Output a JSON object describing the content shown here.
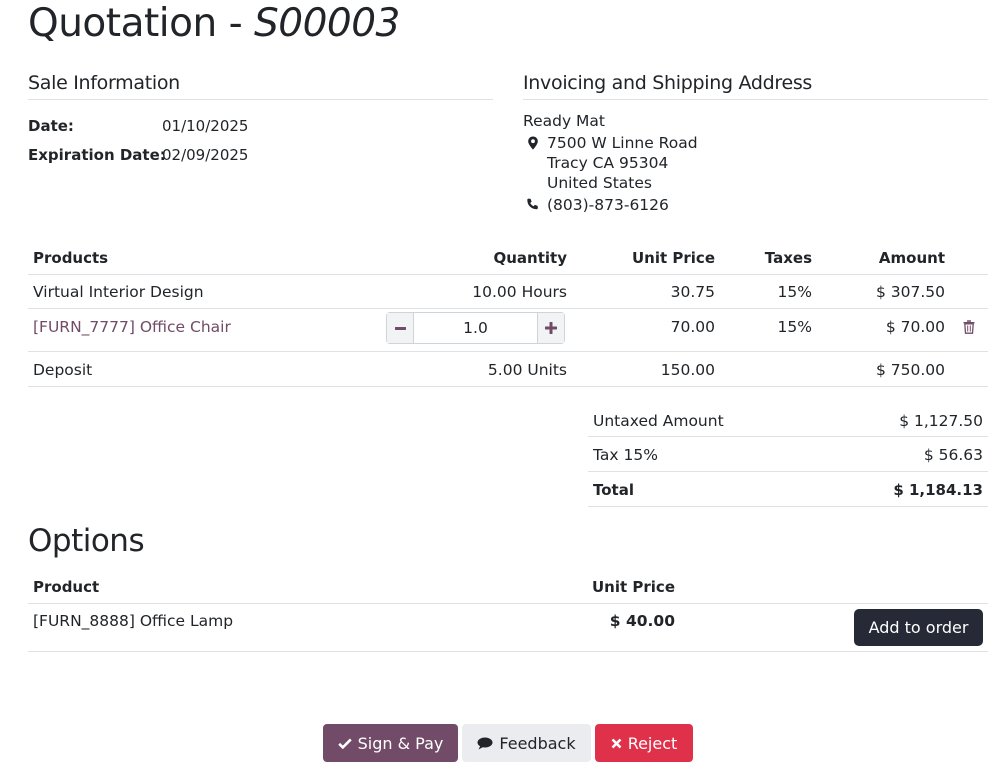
{
  "header": {
    "title_prefix": "Quotation - ",
    "title_ref": "S00003"
  },
  "sale_info": {
    "heading": "Sale Information",
    "date_label": "Date:",
    "date_value": "01/10/2025",
    "expiration_label": "Expiration Date:",
    "expiration_value": "02/09/2025"
  },
  "address": {
    "heading": "Invoicing and Shipping Address",
    "name": "Ready Mat",
    "street": "7500 W Linne Road",
    "city": "Tracy CA 95304",
    "country": "United States",
    "phone": "(803)-873-6126"
  },
  "lines": {
    "headers": {
      "product": "Products",
      "quantity": "Quantity",
      "unit_price": "Unit Price",
      "taxes": "Taxes",
      "amount": "Amount"
    },
    "rows": [
      {
        "product": "Virtual Interior Design",
        "quantity": "10.00 Hours",
        "unit_price": "30.75",
        "taxes": "15%",
        "amount": "$ 307.50"
      },
      {
        "product": "[FURN_7777] Office Chair",
        "quantity": "1.0",
        "unit_price": "70.00",
        "taxes": "15%",
        "amount": "$ 70.00"
      },
      {
        "product": "Deposit",
        "quantity": "5.00 Units",
        "unit_price": "150.00",
        "taxes": "",
        "amount": "$ 750.00"
      }
    ]
  },
  "totals": {
    "untaxed_label": "Untaxed Amount",
    "untaxed_value": "$ 1,127.50",
    "tax_label": "Tax 15%",
    "tax_value": "$ 56.63",
    "total_label": "Total",
    "total_value": "$ 1,184.13"
  },
  "options": {
    "heading": "Options",
    "product_header": "Product",
    "price_header": "Unit Price",
    "rows": [
      {
        "product": "[FURN_8888] Office Lamp",
        "unit_price": "$ 40.00",
        "add_label": "Add to order"
      }
    ]
  },
  "actions": {
    "sign_label": "Sign & Pay",
    "feedback_label": "Feedback",
    "reject_label": "Reject"
  },
  "icons": {
    "location": "map-marker-icon",
    "phone": "phone-icon",
    "trash": "trash-icon",
    "minus": "minus-icon",
    "plus": "plus-icon",
    "check": "check-icon",
    "comment": "comment-icon",
    "close": "close-icon"
  },
  "colors": {
    "brand": "#714B67",
    "danger": "#e0314b",
    "dark_button": "#262a36",
    "rule": "#dee2e6"
  }
}
